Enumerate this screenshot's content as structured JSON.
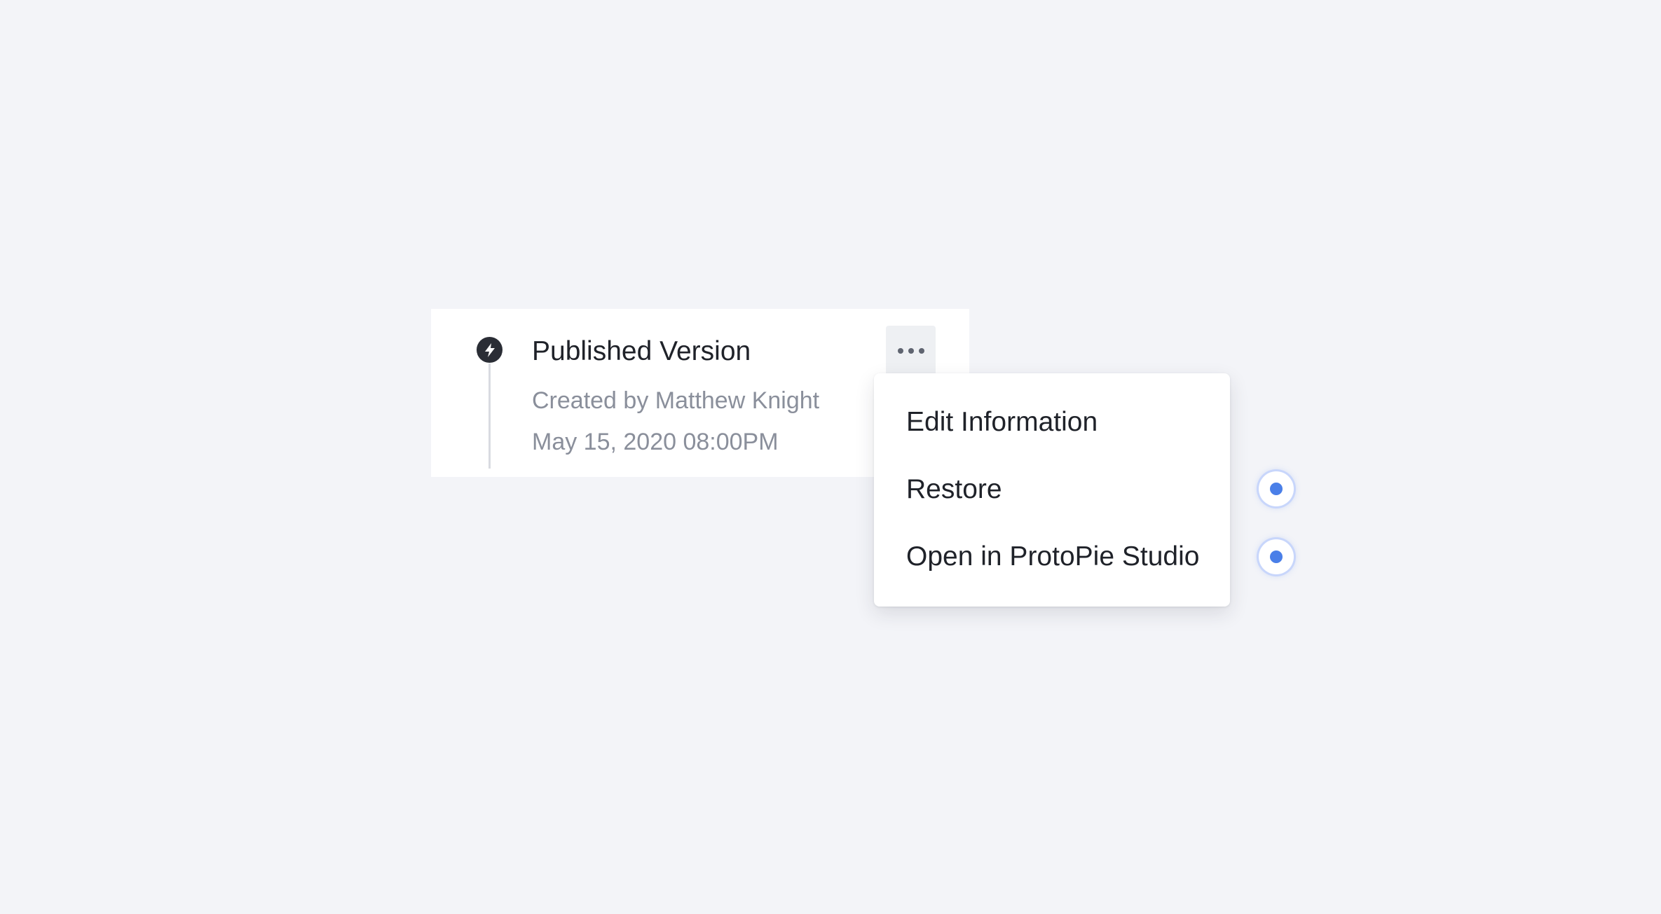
{
  "version_card": {
    "title": "Published Version",
    "author": "Created by Matthew Knight",
    "date": "May 15, 2020 08:00PM",
    "status_icon": "bolt-icon",
    "more_icon": "more-horizontal-icon"
  },
  "menu": {
    "items": [
      {
        "label": "Edit Information"
      },
      {
        "label": "Restore"
      },
      {
        "label": "Open in ProtoPie Studio"
      }
    ]
  },
  "colors": {
    "background": "#f3f4f8",
    "text_primary": "#1f2229",
    "text_secondary": "#8a8f9b",
    "hotspot_blue": "#4a7fe8"
  }
}
